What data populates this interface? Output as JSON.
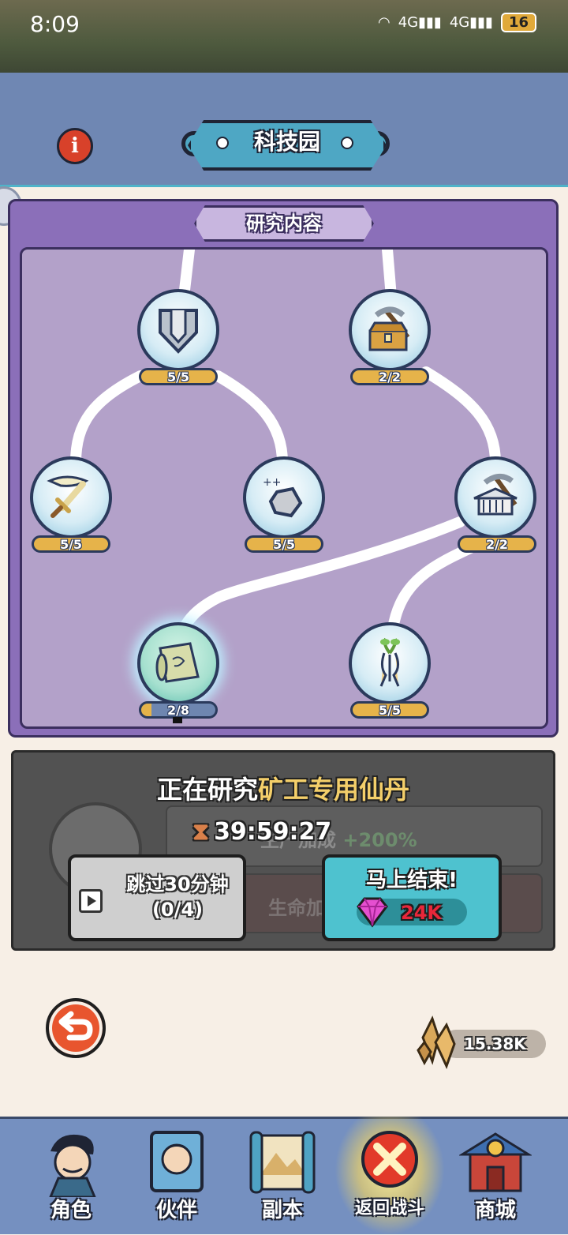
{
  "status_bar": {
    "time": "8:09",
    "network1": "4G",
    "network2": "4G",
    "battery": "16"
  },
  "header": {
    "title": "科技园",
    "info_icon": "info-icon"
  },
  "research_panel": {
    "title": "研究内容",
    "nodes": [
      {
        "id": "armor-down",
        "icon": "armor-icon",
        "progress": "5/5"
      },
      {
        "id": "mine-chest",
        "icon": "treasure-pickaxe-icon",
        "progress": "2/2"
      },
      {
        "id": "sword",
        "icon": "sword-icon",
        "progress": "5/5"
      },
      {
        "id": "ore",
        "icon": "ore-icon",
        "progress": "5/5"
      },
      {
        "id": "mine-temple",
        "icon": "temple-pickaxe-icon",
        "progress": "2/2"
      },
      {
        "id": "scroll",
        "icon": "scroll-icon",
        "progress": "2/8"
      },
      {
        "id": "ginseng",
        "icon": "ginseng-icon",
        "progress": "5/5"
      }
    ]
  },
  "research_status": {
    "prefix": "正在研究",
    "item": "矿工专用仙丹",
    "timer": "39:59:27",
    "bg_row1_label": "生产加成",
    "bg_row1_value": "+200%",
    "bg_row2_label": "生命加成",
    "skip_line1": "跳过30分钟",
    "skip_line2": "(0/4)",
    "finish_label": "马上结束!",
    "finish_cost": "24K"
  },
  "resources": {
    "crystal_amount": "15.38K"
  },
  "bottom_nav": [
    {
      "label": "角色",
      "icon": "character-icon"
    },
    {
      "label": "伙伴",
      "icon": "partner-icon"
    },
    {
      "label": "副本",
      "icon": "dungeon-scroll-icon"
    },
    {
      "label": "返回战斗",
      "icon": "return-battle-icon"
    },
    {
      "label": "商城",
      "icon": "shop-icon"
    }
  ],
  "colors": {
    "panel_purple": "#8b6fb9",
    "header_blue": "#6f87b3",
    "accent_teal": "#4ec2cf",
    "progress_gold": "#e6b34a"
  }
}
